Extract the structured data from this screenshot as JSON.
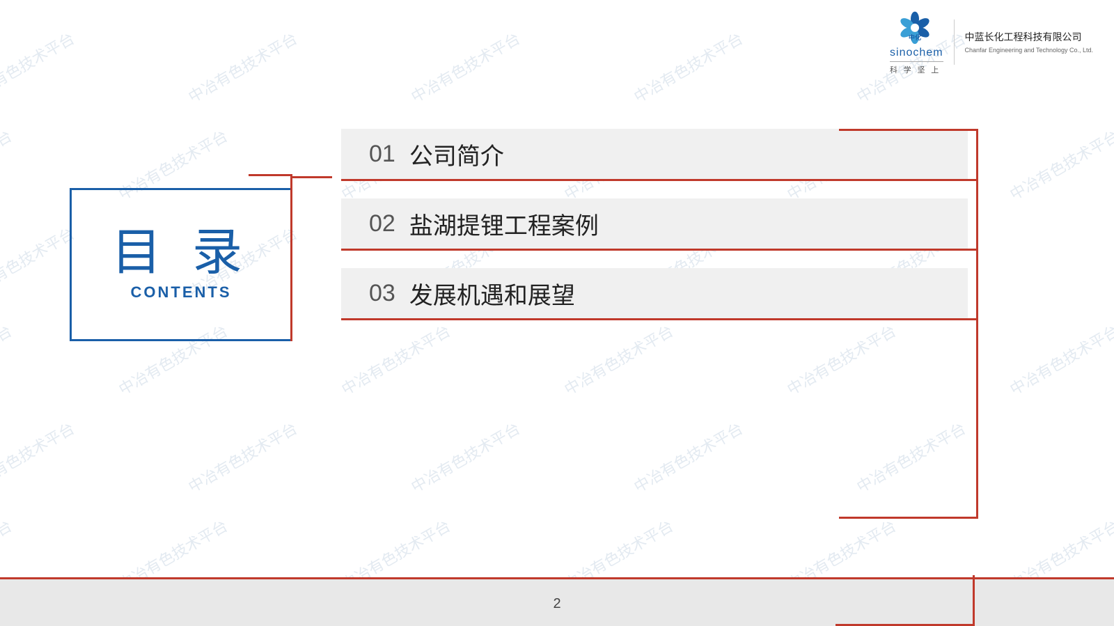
{
  "header": {
    "logo": {
      "brand": "中化",
      "brand_en": "sinochem",
      "tagline": "科 学 坚 上",
      "company_cn": "中蓝长化工程科技有限公司",
      "company_en": "Chanfar Engineering and Technology Co., Ltd."
    }
  },
  "title": {
    "chinese": "目 录",
    "english": "CONTENTS"
  },
  "menu": {
    "items": [
      {
        "number": "01",
        "text": "公司简介"
      },
      {
        "number": "02",
        "text": "盐湖提锂工程案例"
      },
      {
        "number": "03",
        "text": "发展机遇和展望"
      }
    ]
  },
  "watermark": {
    "text": "中冶有色技术平台"
  },
  "page": {
    "number": "2"
  }
}
